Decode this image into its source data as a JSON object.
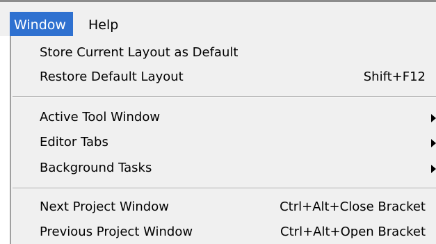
{
  "menubar": {
    "window_label": "Window",
    "help_label": "Help"
  },
  "menu": {
    "groups": [
      [
        {
          "label": "Store Current Layout as Default",
          "shortcut": "",
          "submenu": false
        },
        {
          "label": "Restore Default Layout",
          "shortcut": "Shift+F12",
          "submenu": false
        }
      ],
      [
        {
          "label": "Active Tool Window",
          "shortcut": "",
          "submenu": true
        },
        {
          "label": "Editor Tabs",
          "shortcut": "",
          "submenu": true
        },
        {
          "label": "Background Tasks",
          "shortcut": "",
          "submenu": true
        }
      ],
      [
        {
          "label": "Next Project Window",
          "shortcut": "Ctrl+Alt+Close Bracket",
          "submenu": false
        },
        {
          "label": "Previous Project Window",
          "shortcut": "Ctrl+Alt+Open Bracket",
          "submenu": false
        }
      ]
    ]
  },
  "colors": {
    "menu_background": "#f0f0f0",
    "selected_menu_background": "#2f71d0",
    "selected_menu_text": "#ffffff",
    "separator": "#a0a0a0"
  }
}
